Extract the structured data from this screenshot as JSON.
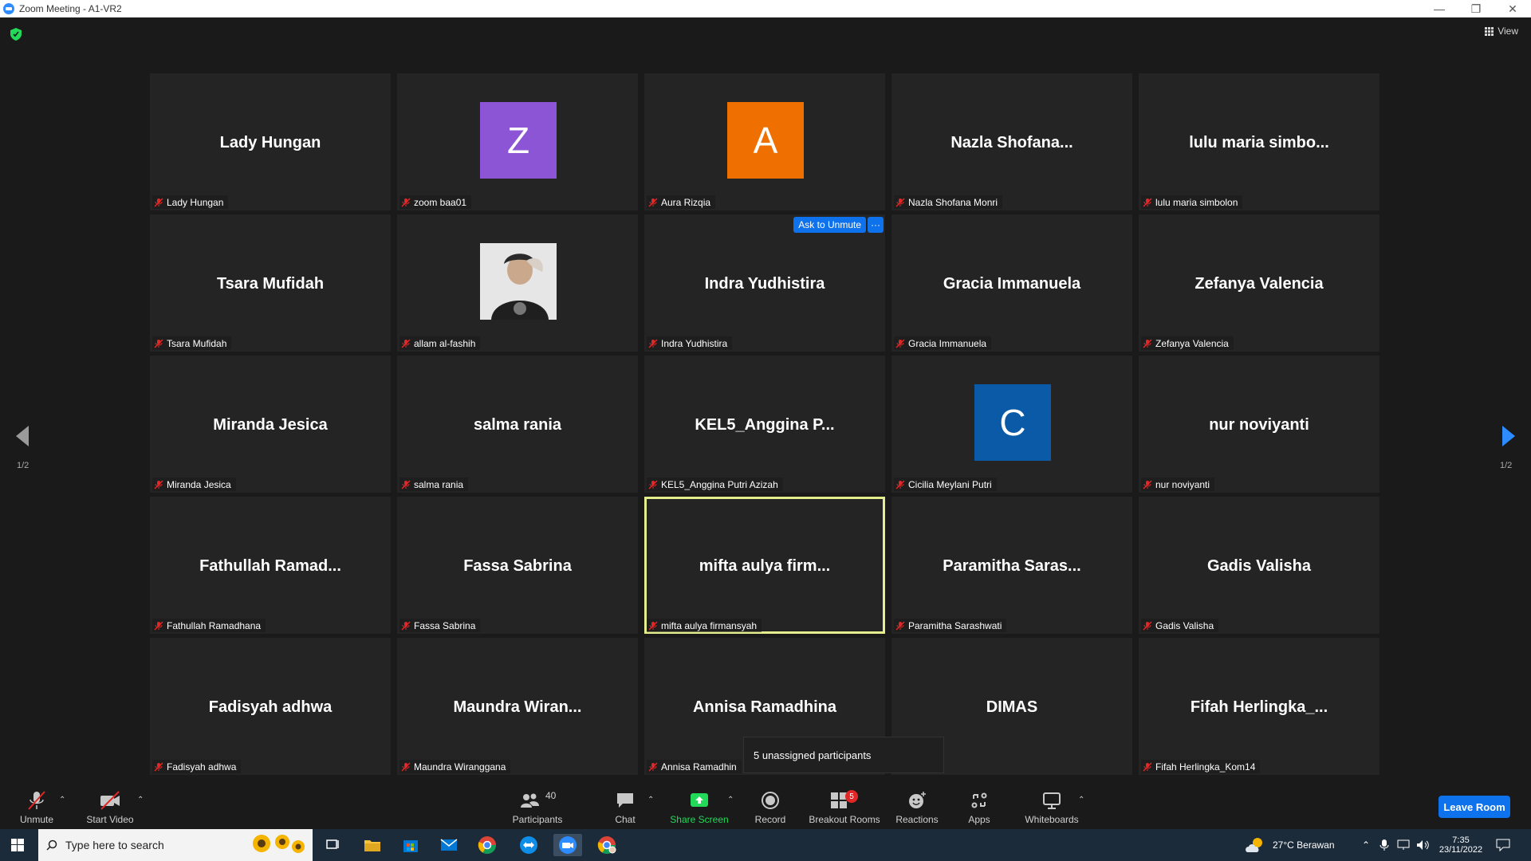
{
  "window": {
    "title": "Zoom Meeting - A1-VR2"
  },
  "view_button": {
    "label": "View"
  },
  "tiles": [
    {
      "display": "Lady Hungan",
      "label": "Lady Hungan"
    },
    {
      "display": "",
      "label": "zoom baa01",
      "avatar_letter": "Z",
      "avatar_color": "#8b55d6"
    },
    {
      "display": "",
      "label": "Aura Rizqia",
      "avatar_letter": "A",
      "avatar_color": "#ef6f00"
    },
    {
      "display": "Nazla  Shofana...",
      "label": "Nazla Shofana Monri"
    },
    {
      "display": "lulu  maria  simbo...",
      "label": "lulu maria simbolon"
    },
    {
      "display": "Tsara Mufidah",
      "label": "Tsara Mufidah"
    },
    {
      "display": "",
      "label": "allam al-fashih",
      "photo": true
    },
    {
      "display": "Indra Yudhistira",
      "label": "Indra Yudhistira"
    },
    {
      "display": "Gracia Immanuela",
      "label": "Gracia Immanuela"
    },
    {
      "display": "Zefanya Valencia",
      "label": "Zefanya Valencia"
    },
    {
      "display": "Miranda Jesica",
      "label": "Miranda Jesica"
    },
    {
      "display": "salma rania",
      "label": "salma rania"
    },
    {
      "display": "KEL5_Anggina  P...",
      "label": "KEL5_Anggina Putri Azizah"
    },
    {
      "display": "",
      "label": "Cicilia Meylani Putri",
      "avatar_letter": "C",
      "avatar_color": "#0a5aa8"
    },
    {
      "display": "nur noviyanti",
      "label": "nur noviyanti"
    },
    {
      "display": "Fathullah  Ramad...",
      "label": "Fathullah Ramadhana"
    },
    {
      "display": "Fassa Sabrina",
      "label": "Fassa Sabrina"
    },
    {
      "display": "mifta  aulya  firm...",
      "label": "mifta aulya firmansyah"
    },
    {
      "display": "Paramitha  Saras...",
      "label": "Paramitha Sarashwati"
    },
    {
      "display": "Gadis Valisha",
      "label": "Gadis Valisha"
    },
    {
      "display": "Fadisyah adhwa",
      "label": "Fadisyah adhwa"
    },
    {
      "display": "Maundra  Wiran...",
      "label": "Maundra Wiranggana"
    },
    {
      "display": "Annisa Ramadhina",
      "label": "Annisa Ramadhin"
    },
    {
      "display": "DIMAS",
      "label": ""
    },
    {
      "display": "Fifah  Herlingka_...",
      "label": "Fifah Herlingka_Kom14"
    }
  ],
  "active_speaker_index": 17,
  "ask_to_unmute": {
    "label": "Ask to Unmute",
    "more": "···"
  },
  "pagination": {
    "left": "1/2",
    "right": "1/2"
  },
  "tooltip": {
    "text": "5 unassigned participants"
  },
  "toolbar": {
    "unmute": "Unmute",
    "start_video": "Start Video",
    "participants": "Participants",
    "participants_count": "40",
    "chat": "Chat",
    "share_screen": "Share Screen",
    "record": "Record",
    "breakout_rooms": "Breakout Rooms",
    "breakout_badge": "5",
    "reactions": "Reactions",
    "apps": "Apps",
    "whiteboards": "Whiteboards",
    "leave": "Leave Room"
  },
  "taskbar": {
    "search_placeholder": "Type here to search",
    "weather": "27°C  Berawan",
    "time": "7:35",
    "date": "23/11/2022"
  },
  "colors": {
    "accent_blue": "#0e72ed",
    "active_speaker": "#e5ee8d",
    "share_green": "#23d959",
    "muted_red": "#e02828"
  }
}
